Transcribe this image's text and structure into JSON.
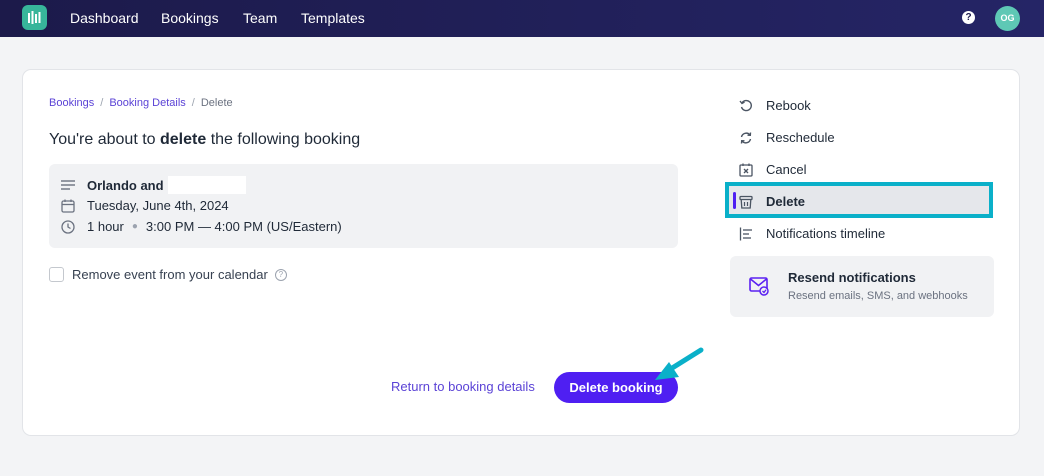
{
  "nav": {
    "items": [
      "Dashboard",
      "Bookings",
      "Team",
      "Templates"
    ],
    "help_glyph": "?",
    "avatar_initials": "OG"
  },
  "breadcrumb": {
    "items": [
      "Bookings",
      "Booking Details",
      "Delete"
    ],
    "separator": "/"
  },
  "heading": {
    "prefix": "You're about to ",
    "emphasis": "delete",
    "suffix": " the following booking"
  },
  "booking": {
    "name": "Orlando and",
    "date": "Tuesday, June 4th, 2024",
    "duration": "1 hour",
    "time": "3:00 PM — 4:00 PM (US/Eastern)"
  },
  "checkbox": {
    "label": "Remove event from your calendar",
    "checked": false
  },
  "actions": {
    "return_label": "Return to booking details",
    "delete_label": "Delete booking"
  },
  "side_menu": {
    "items": [
      {
        "label": "Rebook",
        "icon": "rebook-icon"
      },
      {
        "label": "Reschedule",
        "icon": "reschedule-icon"
      },
      {
        "label": "Cancel",
        "icon": "cancel-calendar-icon"
      },
      {
        "label": "Delete",
        "icon": "trash-icon",
        "active": true
      },
      {
        "label": "Notifications timeline",
        "icon": "timeline-icon"
      }
    ]
  },
  "resend": {
    "title": "Resend notifications",
    "subtitle": "Resend emails, SMS, and webhooks"
  },
  "colors": {
    "accent": "#4f1ff2",
    "link": "#5b43d6",
    "highlight": "#0ab0c9",
    "logo": "#37b59a"
  }
}
